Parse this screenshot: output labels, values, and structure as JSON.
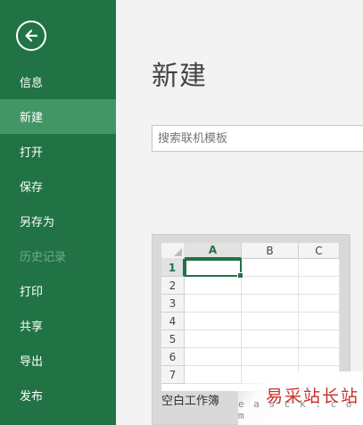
{
  "sidebar": {
    "back_icon": "arrow-left-icon",
    "items": [
      {
        "label": "信息"
      },
      {
        "label": "新建"
      },
      {
        "label": "打开"
      },
      {
        "label": "保存"
      },
      {
        "label": "另存为"
      },
      {
        "label": "历史记录"
      },
      {
        "label": "打印"
      },
      {
        "label": "共享"
      },
      {
        "label": "导出"
      },
      {
        "label": "发布"
      }
    ],
    "active_item": "新建",
    "disabled_item": "历史记录"
  },
  "main": {
    "title": "新建",
    "search": {
      "placeholder": "搜索联机模板",
      "value": ""
    },
    "template": {
      "name": "空白工作簿",
      "columns": [
        "A",
        "B",
        "C"
      ],
      "rows": [
        "1",
        "2",
        "3",
        "4",
        "5",
        "6",
        "7"
      ],
      "active_cell": "A1"
    }
  },
  "watermark": {
    "text": "易采站长站",
    "url": "e a s c k . c o m"
  },
  "colors": {
    "sidebar": "#217346",
    "active": "#439467",
    "watermark": "#c8302c"
  }
}
